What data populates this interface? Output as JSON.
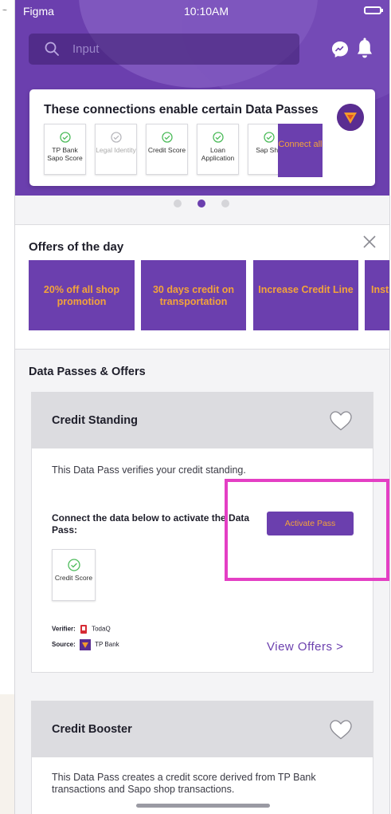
{
  "status_bar": {
    "carrier": "Figma",
    "time": "10:10AM"
  },
  "search": {
    "placeholder": "Input"
  },
  "connections": {
    "title": "These connections enable certain Data Passes",
    "tiles": [
      {
        "label": "TP Bank Sapo Score",
        "enabled": true
      },
      {
        "label": "Legal Identity",
        "enabled": false
      },
      {
        "label": "Credit Score",
        "enabled": true
      },
      {
        "label": "Loan Application",
        "enabled": true
      },
      {
        "label": "Sap Sho",
        "enabled": true
      }
    ],
    "connect_all_label": "Connect all"
  },
  "carousel": {
    "page_count": 3,
    "active_index": 1
  },
  "offers": {
    "title": "Offers of the day",
    "items": [
      "20% off all shop promotion",
      "30 days credit on transportation",
      "Increase Credit Line",
      "Inst"
    ]
  },
  "section_title": "Data Passes & Offers",
  "passes": [
    {
      "name": "Credit Standing",
      "description": "This Data Pass verifies your credit standing.",
      "connect_text": "Connect the data below to activate the Data Pass:",
      "activate_label": "Activate Pass",
      "tile_label": "Credit Score",
      "verifier_label": "Verifier:",
      "verifier_name": "TodaQ",
      "source_label": "Source:",
      "source_name": "TP Bank",
      "view_offers_label": "View Offers >"
    },
    {
      "name": "Credit Booster",
      "description": "This Data Pass creates a credit score derived from TP Bank transactions and Sapo shop transactions."
    }
  ],
  "colors": {
    "brand_purple": "#6b3fae",
    "accent_orange": "#f3a33a",
    "check_green": "#4cbb5a",
    "highlight_pink": "#e43fc4"
  }
}
